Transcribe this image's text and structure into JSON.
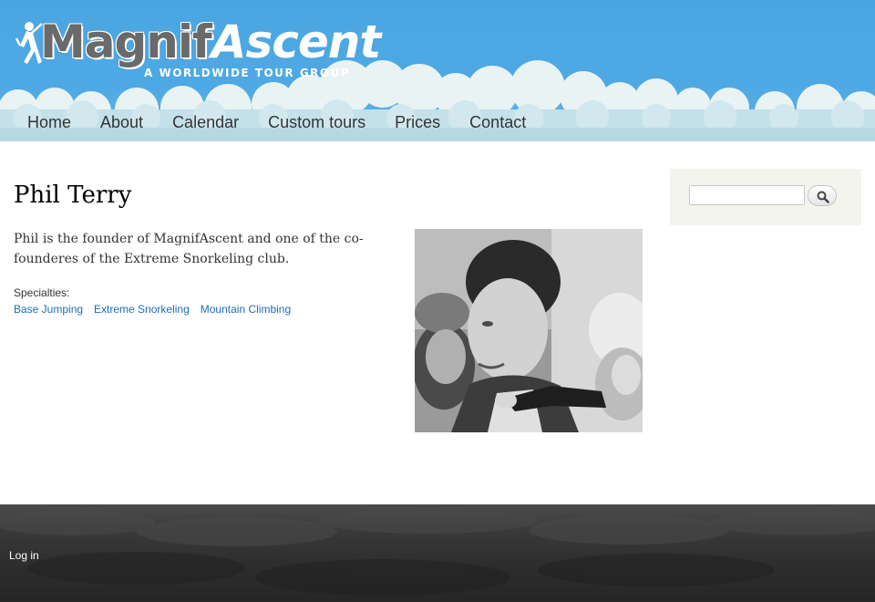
{
  "brand": {
    "name_part1": "Magnif",
    "name_part2": "Ascent",
    "tagline": "A WORLDWIDE TOUR GROUP",
    "colors": {
      "sky": "#4aa6e2",
      "link": "#1f6db5",
      "sidebar_bg": "#f4f4ef",
      "footer": "#333333"
    }
  },
  "nav": {
    "items": [
      {
        "label": "Home"
      },
      {
        "label": "About"
      },
      {
        "label": "Calendar"
      },
      {
        "label": "Custom tours"
      },
      {
        "label": "Prices"
      },
      {
        "label": "Contact"
      }
    ]
  },
  "main": {
    "title": "Phil Terry",
    "bio": "Phil is the founder of MagnifAscent and one of the co-founderes of the Extreme Snorkeling club.",
    "specialties_label": "Specialties:",
    "specialties": [
      {
        "label": "Base Jumping"
      },
      {
        "label": "Extreme Snorkeling"
      },
      {
        "label": "Mountain Climbing"
      }
    ]
  },
  "sidebar": {
    "search": {
      "value": "",
      "placeholder": "",
      "button_icon": "search-icon"
    }
  },
  "footer": {
    "login_label": "Log in"
  }
}
